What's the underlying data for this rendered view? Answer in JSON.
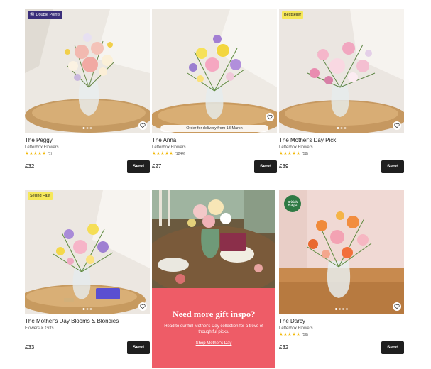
{
  "colors": {
    "send_button": "#1f1f1f",
    "star": "#f2b807",
    "promo_bg": "#ee5c67",
    "badge_purple": "#3a2e7a",
    "badge_yellow": "#f6e85a"
  },
  "products": [
    {
      "badge": "Double Points",
      "badge_icon": "gift-icon",
      "name": "The Peggy",
      "brand": "Letterbox Flowers",
      "stars": "★★★★★",
      "rating_value": 5,
      "review_count": "(1)",
      "price": "£32",
      "send_label": "Send",
      "carousel_total": 3,
      "carousel_active": 1,
      "order_note": ""
    },
    {
      "badge": "",
      "name": "The Anna",
      "brand": "Letterbox Flowers",
      "stars": "★★★★★",
      "rating_value": 5,
      "review_count": "(1244)",
      "price": "£27",
      "send_label": "Send",
      "carousel_total": 3,
      "carousel_active": 1,
      "order_note": "Order for delivery from 13 March"
    },
    {
      "badge": "Bestseller",
      "name": "The Mother's Day Pick",
      "brand": "Letterbox Flowers",
      "stars": "★★★★★",
      "rating_value": 5,
      "review_count": "(58)",
      "price": "£39",
      "send_label": "Send",
      "carousel_total": 3,
      "carousel_active": 1,
      "order_note": ""
    },
    {
      "badge": "Selling Fast",
      "name": "The Mother's Day Blooms & Blondies",
      "brand": "Flowers & Gifts",
      "stars": "",
      "review_count": "",
      "price": "£33",
      "send_label": "Send",
      "carousel_total": 3,
      "carousel_active": 1,
      "order_note": ""
    },
    {
      "badge": "",
      "name": "The Darcy",
      "brand": "Letterbox Flowers",
      "stars": "★★★★★",
      "rating_value": 5,
      "review_count": "(56)",
      "price": "£32",
      "send_label": "Send",
      "carousel_total": 4,
      "carousel_active": 1,
      "order_note": "",
      "image_sticker": "British Tulips"
    }
  ],
  "promo": {
    "title": "Need more gift inspo?",
    "text": "Head to our full Mother's Day collection for a trove of thoughtful picks.",
    "link": "Shop Mother's Day"
  }
}
